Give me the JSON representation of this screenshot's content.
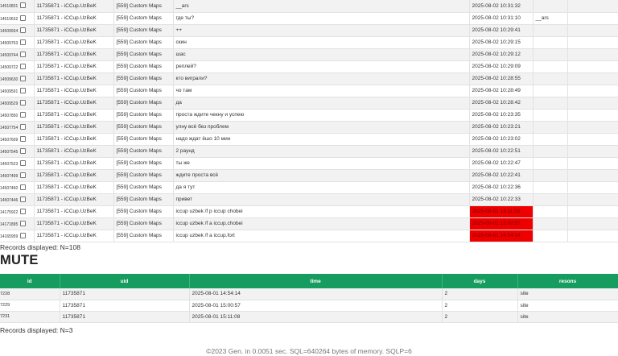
{
  "log": {
    "rows": [
      {
        "id": "14510831",
        "uid": "11735871 - iCCup.UzBeK",
        "map": "[559] Custom Maps",
        "message": "__ars",
        "time": "2025-08-02 10:31:32",
        "extra": "",
        "highlight": false
      },
      {
        "id": "14510632",
        "uid": "11735871 - iCCup.UzBeK",
        "map": "[559] Custom Maps",
        "message": "где ты?",
        "time": "2025-08-02 10:31:10",
        "extra": "__ars",
        "highlight": false
      },
      {
        "id": "14509934",
        "uid": "11735871 - iCCup.UzBeK",
        "map": "[559] Custom Maps",
        "message": "++",
        "time": "2025-08-02 10:29:41",
        "extra": "",
        "highlight": false
      },
      {
        "id": "14509763",
        "uid": "11735871 - iCCup.UzBeK",
        "map": "[559] Custom Maps",
        "message": "скин",
        "time": "2025-08-02 10:29:15",
        "extra": "",
        "highlight": false
      },
      {
        "id": "14509744",
        "uid": "11735871 - iCCup.UzBeK",
        "map": "[559] Custom Maps",
        "message": "шас",
        "time": "2025-08-02 10:29:12",
        "extra": "",
        "highlight": false
      },
      {
        "id": "14509722",
        "uid": "11735871 - iCCup.UzBeK",
        "map": "[559] Custom Maps",
        "message": "реплей?",
        "time": "2025-08-02 10:29:09",
        "extra": "",
        "highlight": false
      },
      {
        "id": "14509630",
        "uid": "11735871 - iCCup.UzBeK",
        "map": "[559] Custom Maps",
        "message": "кто виграли?",
        "time": "2025-08-02 10:28:55",
        "extra": "",
        "highlight": false
      },
      {
        "id": "14509591",
        "uid": "11735871 - iCCup.UzBeK",
        "map": "[559] Custom Maps",
        "message": "чо там",
        "time": "2025-08-02 10:28:49",
        "extra": "",
        "highlight": false
      },
      {
        "id": "14509529",
        "uid": "11735871 - iCCup.UzBeK",
        "map": "[559] Custom Maps",
        "message": "да",
        "time": "2025-08-02 10:28:42",
        "extra": "",
        "highlight": false
      },
      {
        "id": "14507850",
        "uid": "11735871 - iCCup.UzBeK",
        "map": "[559] Custom Maps",
        "message": "проста ждите чекну и успею",
        "time": "2025-08-02 10:23:35",
        "extra": "",
        "highlight": false
      },
      {
        "id": "14507754",
        "uid": "11735871 - iCCup.UzBeK",
        "map": "[559] Custom Maps",
        "message": "улну всё без проблем",
        "time": "2025-08-02 10:23:21",
        "extra": "",
        "highlight": false
      },
      {
        "id": "14507609",
        "uid": "11735871 - iCCup.UzBeK",
        "map": "[559] Custom Maps",
        "message": "надо ждат ёшо 10 мин",
        "time": "2025-08-02 10:23:02",
        "extra": "",
        "highlight": false
      },
      {
        "id": "14507545",
        "uid": "11735871 - iCCup.UzBeK",
        "map": "[559] Custom Maps",
        "message": "2 раунд",
        "time": "2025-08-02 10:22:51",
        "extra": "",
        "highlight": false
      },
      {
        "id": "14507523",
        "uid": "11735871 - iCCup.UzBeK",
        "map": "[559] Custom Maps",
        "message": "ты же",
        "time": "2025-08-02 10:22:47",
        "extra": "",
        "highlight": false
      },
      {
        "id": "14507499",
        "uid": "11735871 - iCCup.UzBeK",
        "map": "[559] Custom Maps",
        "message": "ждите проста всё",
        "time": "2025-08-02 10:22:41",
        "extra": "",
        "highlight": false
      },
      {
        "id": "14507460",
        "uid": "11735871 - iCCup.UzBeK",
        "map": "[559] Custom Maps",
        "message": "да я тут",
        "time": "2025-08-02 10:22:36",
        "extra": "",
        "highlight": false
      },
      {
        "id": "14507446",
        "uid": "11735871 - iCCup.UzBeK",
        "map": "[559] Custom Maps",
        "message": "привет",
        "time": "2025-08-02 10:22:33",
        "extra": "",
        "highlight": false
      },
      {
        "id": "14175922",
        "uid": "11735871 - iCCup.UzBeK",
        "map": "[559] Custom Maps",
        "message": "iccup uzbek /f p iccup chobei",
        "time": "2025-08-01 15:11:08",
        "extra": "",
        "highlight": true
      },
      {
        "id": "14171895",
        "uid": "11735871 - iCCup.UzBeK",
        "map": "[559] Custom Maps",
        "message": "iccup uzbek /f a iccup.chobei",
        "time": "2025-08-01 15:00:57",
        "extra": "",
        "highlight": true
      },
      {
        "id": "14165959",
        "uid": "11735871 - iCCup.UzBeK",
        "map": "[559] Custom Maps",
        "message": "iccup uzbek /f a iccup.fort",
        "time": "2025-08-01 14:54:14",
        "extra": "",
        "highlight": true
      }
    ],
    "records_text": "Records displayed: N=108"
  },
  "mute": {
    "title": "MUTE",
    "headers": {
      "id": "id",
      "uid": "uid",
      "time": "time",
      "days": "days",
      "reason": "resons"
    },
    "rows": [
      {
        "id": "7228",
        "uid": "11735871",
        "time": "2025-08-01 14:54:14",
        "days": "2",
        "reason": "site"
      },
      {
        "id": "7229",
        "uid": "11735871",
        "time": "2025-08-01 15:00:57",
        "days": "2",
        "reason": "site"
      },
      {
        "id": "7231",
        "uid": "11735871",
        "time": "2025-08-01 15:11:08",
        "days": "2",
        "reason": "site"
      }
    ],
    "records_text": "Records displayed: N=3"
  },
  "footer": {
    "text": "©2023 Gen. in 0.0051 sec. SQL=640264 bytes of memory. SQLP=6"
  },
  "colors": {
    "header_green": "#169c5e",
    "highlight_red": "#ee0000"
  }
}
